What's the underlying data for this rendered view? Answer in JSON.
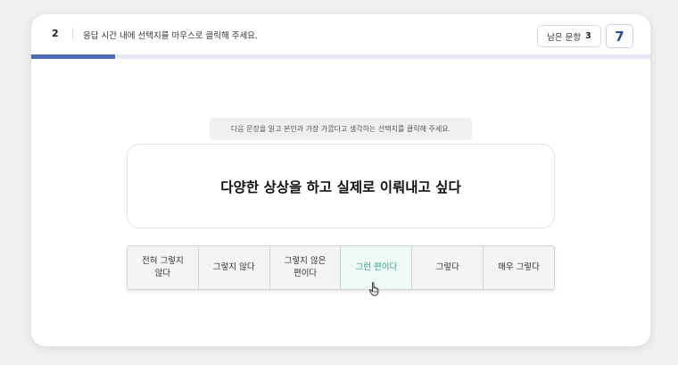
{
  "header": {
    "question_number": "2",
    "instruction": "응답 시간 내에 선택지를 마우스로 클릭해 주세요.",
    "remaining_label": "남은 문항",
    "remaining_count": "3",
    "timer": "7"
  },
  "progress": {
    "fraction": 0.135,
    "fill_color": "#4f6db0",
    "track_color": "#e6eaf3"
  },
  "guide_text": "다음 문장을 읽고 본인과 가장 가깝다고 생각하는 선택지를 클릭해 주세요.",
  "statement": "다양한 상상을 하고 실제로 이뤄내고 싶다",
  "options": [
    {
      "label": "전혀 그렇지\n않다"
    },
    {
      "label": "그렇지 않다"
    },
    {
      "label": "그렇지 않은\n편이다"
    },
    {
      "label": "그런 편이다"
    },
    {
      "label": "그렇다"
    },
    {
      "label": "매우 그렇다"
    }
  ],
  "hovered_option": "그런 편이다",
  "cursor_icon": "hand-pointer-icon"
}
